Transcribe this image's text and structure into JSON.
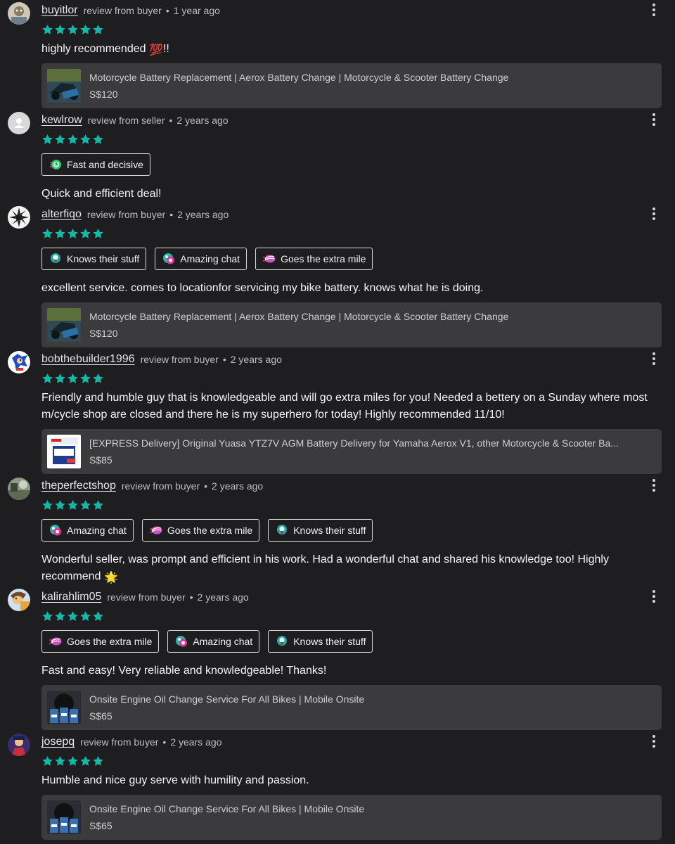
{
  "star_color": "#14b8a6",
  "reviews": [
    {
      "username": "buyitlor",
      "review_type": "review from buyer",
      "time": "1 year ago",
      "rating": 5,
      "text": "highly recommended",
      "text_emoji": "💯",
      "text_suffix": "!!",
      "listing": {
        "title": "Motorcycle Battery Replacement | Aerox Battery Change | Motorcycle & Scooter Battery Change",
        "price": "S$120"
      }
    },
    {
      "username": "kewlrow",
      "review_type": "review from seller",
      "time": "2 years ago",
      "rating": 5,
      "tags": [
        {
          "label": "Fast and decisive",
          "icon": "clock-icon"
        }
      ],
      "text": "Quick and efficient deal!"
    },
    {
      "username": "alterfiqo",
      "review_type": "review from buyer",
      "time": "2 years ago",
      "rating": 5,
      "tags": [
        {
          "label": "Knows their stuff",
          "icon": "lightbulb-icon"
        },
        {
          "label": "Amazing chat",
          "icon": "chat-bubble-icon"
        },
        {
          "label": "Goes the extra mile",
          "icon": "rocket-icon"
        }
      ],
      "text": "excellent service. comes to locationfor servicing my bike battery. knows what he is doing.",
      "listing": {
        "title": "Motorcycle Battery Replacement | Aerox Battery Change | Motorcycle & Scooter Battery Change",
        "price": "S$120"
      }
    },
    {
      "username": "bobthebuilder1996",
      "review_type": "review from buyer",
      "time": "2 years ago",
      "rating": 5,
      "text": "Friendly and humble guy that is knowledgeable and will go extra miles for you! Needed a bettery on a Sunday where most m/cycle shop are closed and there he is my superhero for today! Highly recommended 11/10!",
      "listing": {
        "title": "[EXPRESS Delivery] Original Yuasa YTZ7V AGM Battery Delivery for Yamaha Aerox V1, other Motorcycle & Scooter Ba...",
        "price": "S$85"
      }
    },
    {
      "username": "theperfectshop",
      "review_type": "review from buyer",
      "time": "2 years ago",
      "rating": 5,
      "tags": [
        {
          "label": "Amazing chat",
          "icon": "chat-bubble-icon"
        },
        {
          "label": "Goes the extra mile",
          "icon": "rocket-icon"
        },
        {
          "label": "Knows their stuff",
          "icon": "lightbulb-icon"
        }
      ],
      "text": "Wonderful seller, was prompt and efficient in his work. Had a wonderful chat and shared his knowledge too! Highly recommend",
      "text_emoji": "🌟"
    },
    {
      "username": "kalirahlim05",
      "review_type": "review from buyer",
      "time": "2 years ago",
      "rating": 5,
      "tags": [
        {
          "label": "Goes the extra mile",
          "icon": "rocket-icon"
        },
        {
          "label": "Amazing chat",
          "icon": "chat-bubble-icon"
        },
        {
          "label": "Knows their stuff",
          "icon": "lightbulb-icon"
        }
      ],
      "text": "Fast and easy! Very reliable and knowledgeable! Thanks!",
      "listing": {
        "title": "Onsite Engine Oil Change Service For All Bikes | Mobile Onsite",
        "price": "S$65"
      }
    },
    {
      "username": "josepq",
      "review_type": "review from buyer",
      "time": "2 years ago",
      "rating": 5,
      "text": "Humble and nice guy serve with humility and passion.",
      "listing": {
        "title": "Onsite Engine Oil Change Service For All Bikes | Mobile Onsite",
        "price": "S$65"
      }
    }
  ]
}
